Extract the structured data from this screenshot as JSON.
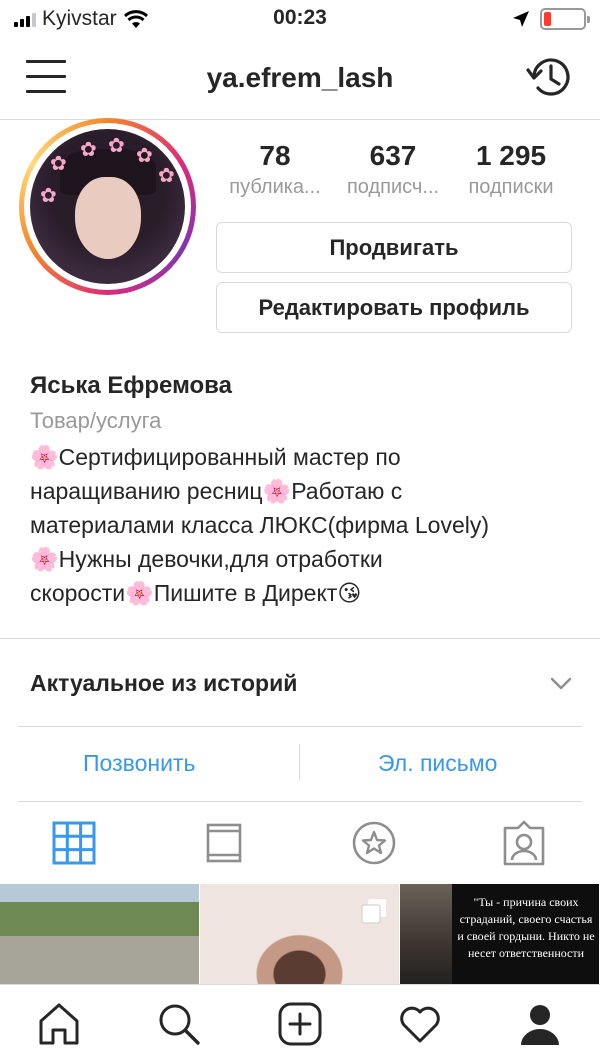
{
  "status_bar": {
    "carrier": "Kyivstar",
    "time": "00:23",
    "battery_color": "#ff3b30",
    "icons": [
      "signal-icon",
      "wifi-icon",
      "location-arrow-icon",
      "battery-icon"
    ]
  },
  "header": {
    "username": "ya.efrem_lash",
    "icons": [
      "menu-icon",
      "history-icon"
    ]
  },
  "profile": {
    "stats": [
      {
        "value": "78",
        "label": "публика..."
      },
      {
        "value": "637",
        "label": "подписч..."
      },
      {
        "value": "1 295",
        "label": "подписки"
      }
    ],
    "promote_button": "Продвигать",
    "edit_button": "Редактировать профиль",
    "name": "Яська Ефремова",
    "category": "Товар/услуга",
    "bio": "🌸Сертифицированный мастер по\nнаращиванию ресниц🌸Работаю с\nматериалами класса ЛЮКС(фирма Lovely)\n🌸Нужны девочки,для отработки\nскорости🌸Пишите в Директ😘"
  },
  "highlights": {
    "title": "Актуальное из историй"
  },
  "contact": {
    "call": "Позвонить",
    "email": "Эл. письмо",
    "link_color": "#3897f0"
  },
  "tabs": {
    "items": [
      "grid-icon",
      "feed-icon",
      "saved-icon",
      "tagged-icon"
    ],
    "active_color": "#3897f0"
  },
  "posts": {
    "quote_text": "\"Ты - причина своих страданий, своего счастья и своей гордыни. Никто не несет ответственности"
  },
  "bottom_nav": {
    "items": [
      "home-icon",
      "search-icon",
      "add-post-icon",
      "activity-heart-icon",
      "profile-icon"
    ]
  }
}
